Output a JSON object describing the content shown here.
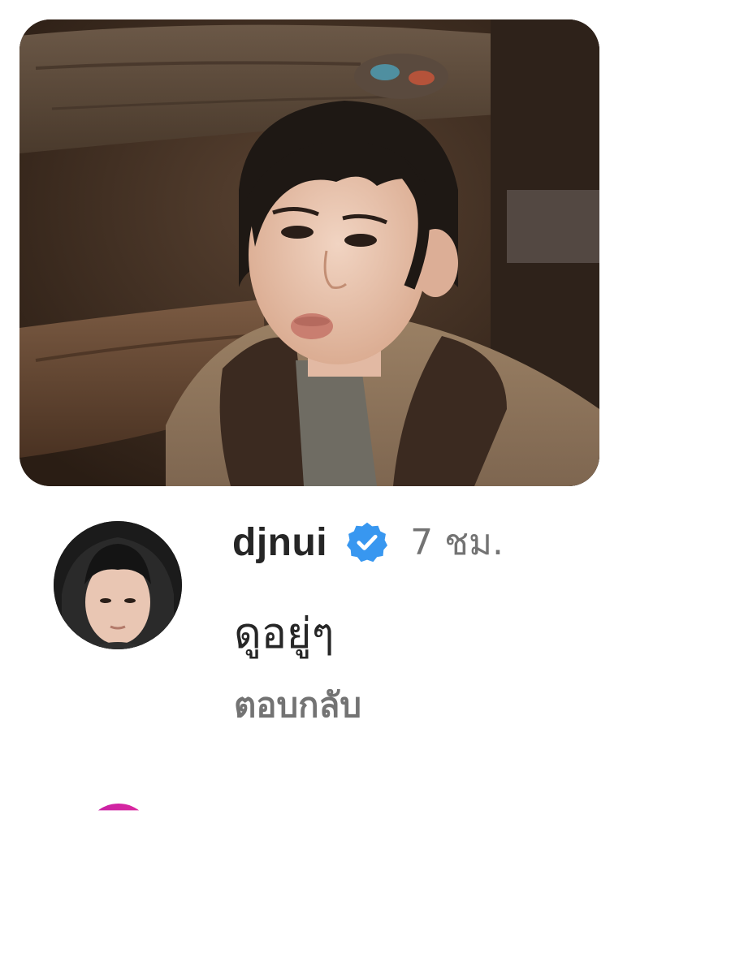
{
  "post": {
    "photo_alt": "post-photo"
  },
  "comment": {
    "username": "djnui",
    "verified_icon": "verified-badge-icon",
    "verified_color": "#3897f0",
    "timestamp": "7 ชม.",
    "text": "ดูอยู่ๆ",
    "reply_label": "ตอบกลับ"
  },
  "next_comment": {
    "avatar_ring_color": "#d4249f"
  }
}
